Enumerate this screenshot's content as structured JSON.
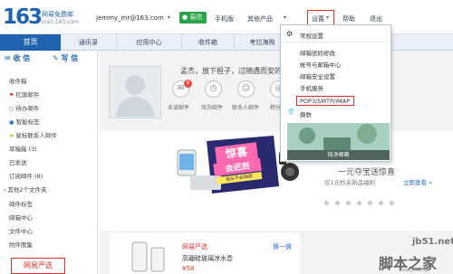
{
  "header": {
    "logo_number": "163",
    "logo_text": "网易免费邮",
    "logo_domain": "mail.163.com",
    "account": "jemmy_mr@163.com",
    "yixin_label": "易信",
    "links": [
      "手机版",
      "其他产品",
      "设置",
      "帮助",
      "退出"
    ]
  },
  "nav": {
    "home": "首页",
    "tabs": [
      "通讯录",
      "应用中心",
      "收件箱",
      "考拉海购"
    ]
  },
  "sidebar": {
    "receive": "收 信",
    "write": "写 信",
    "items": [
      {
        "icon": "",
        "label": "收件箱"
      },
      {
        "icon": "⚑",
        "label": "红旗邮件"
      },
      {
        "icon": "○",
        "label": "待办邮件"
      },
      {
        "icon": "▣",
        "label": "智能标签"
      },
      {
        "icon": "★",
        "label": "星标联系人邮件"
      },
      {
        "icon": "",
        "label": "草稿箱 (3)"
      },
      {
        "icon": "",
        "label": "已发送"
      },
      {
        "icon": "",
        "label": "订阅邮件 (8)"
      },
      {
        "icon": "›",
        "label": "其他2个文件夹"
      },
      {
        "icon": "",
        "label": "邮件标签"
      },
      {
        "icon": "",
        "label": "邮箱中心"
      },
      {
        "icon": "",
        "label": "文件中心"
      },
      {
        "icon": "",
        "label": "附件图集"
      }
    ],
    "promo": "网易严选"
  },
  "welcome": {
    "greeting": "孟杰，放下担子，过随遇而安的生",
    "badge": "8",
    "quick_links": [
      "未读邮件",
      "待办邮件",
      "联系人邮件",
      "积分"
    ]
  },
  "banner": {
    "title_line1": "惊喜",
    "title_line2": "会迟到",
    "title_line3": "但从不会缺席",
    "prize_title": "一元夺宝送惊喜",
    "prize_sub": "仅1元秒杀新品福利",
    "prize_link": "立即查看 »"
  },
  "panel": {
    "heading": "网易严选",
    "swap": "换一换",
    "line1": "高硼硅玻璃凉水壶",
    "line2": "¥58"
  },
  "settings_menu": {
    "items": [
      "常规设置",
      "邮箱密码修改",
      "帐号与邮箱中心",
      "邮箱安全设置",
      "手机服务",
      "POP3/SMTP/IMAP",
      "换肤"
    ],
    "skin_caption": "纯净邮箱"
  },
  "watermark": {
    "line1": "jb51.net",
    "line2": "脚本之家",
    "line3": "www.jb51.net"
  },
  "colors": {
    "brand_blue": "#1f62ad",
    "highlight_red": "#d9312b",
    "yixin_green": "#2aa34a"
  }
}
